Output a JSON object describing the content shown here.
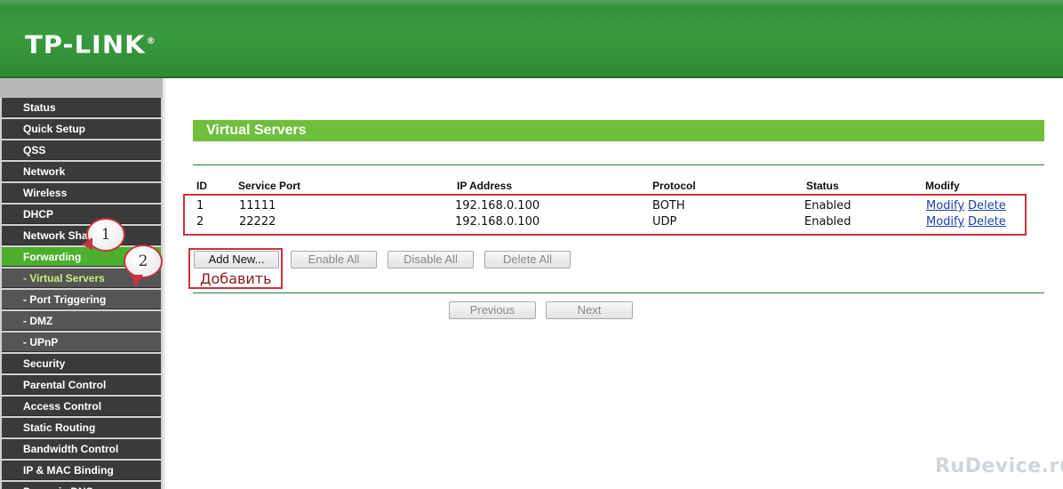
{
  "brand": {
    "logo_text": "TP-LINK",
    "logo_reg": "®"
  },
  "sidebar": {
    "items": [
      {
        "label": "Status"
      },
      {
        "label": "Quick Setup"
      },
      {
        "label": "QSS"
      },
      {
        "label": "Network"
      },
      {
        "label": "Wireless"
      },
      {
        "label": "DHCP"
      },
      {
        "label": "Network Sharing"
      },
      {
        "label": "Forwarding"
      },
      {
        "label": "- Virtual Servers"
      },
      {
        "label": "- Port Triggering"
      },
      {
        "label": "- DMZ"
      },
      {
        "label": "- UPnP"
      },
      {
        "label": "Security"
      },
      {
        "label": "Parental Control"
      },
      {
        "label": "Access Control"
      },
      {
        "label": "Static Routing"
      },
      {
        "label": "Bandwidth Control"
      },
      {
        "label": "IP & MAC Binding"
      },
      {
        "label": "Dynamic DNS"
      }
    ]
  },
  "callouts": {
    "one": "1",
    "two": "2"
  },
  "page": {
    "title": "Virtual Servers"
  },
  "table": {
    "headers": [
      "ID",
      "Service Port",
      "IP Address",
      "Protocol",
      "Status",
      "Modify"
    ],
    "rows": [
      {
        "id": "1",
        "port": "11111",
        "ip": "192.168.0.100",
        "protocol": "BOTH",
        "status": "Enabled",
        "modify": "Modify",
        "delete": "Delete"
      },
      {
        "id": "2",
        "port": "22222",
        "ip": "192.168.0.100",
        "protocol": "UDP",
        "status": "Enabled",
        "modify": "Modify",
        "delete": "Delete"
      }
    ]
  },
  "buttons": {
    "add_new": "Add New...",
    "enable_all": "Enable All",
    "disable_all": "Disable All",
    "delete_all": "Delete All",
    "previous": "Previous",
    "next": "Next"
  },
  "annotation": {
    "add_caption": "Добавить"
  },
  "watermark": {
    "text": "RuDevice.ru"
  },
  "colors": {
    "accent_green": "#6fbf3c",
    "annotation_red": "#c8343c"
  }
}
